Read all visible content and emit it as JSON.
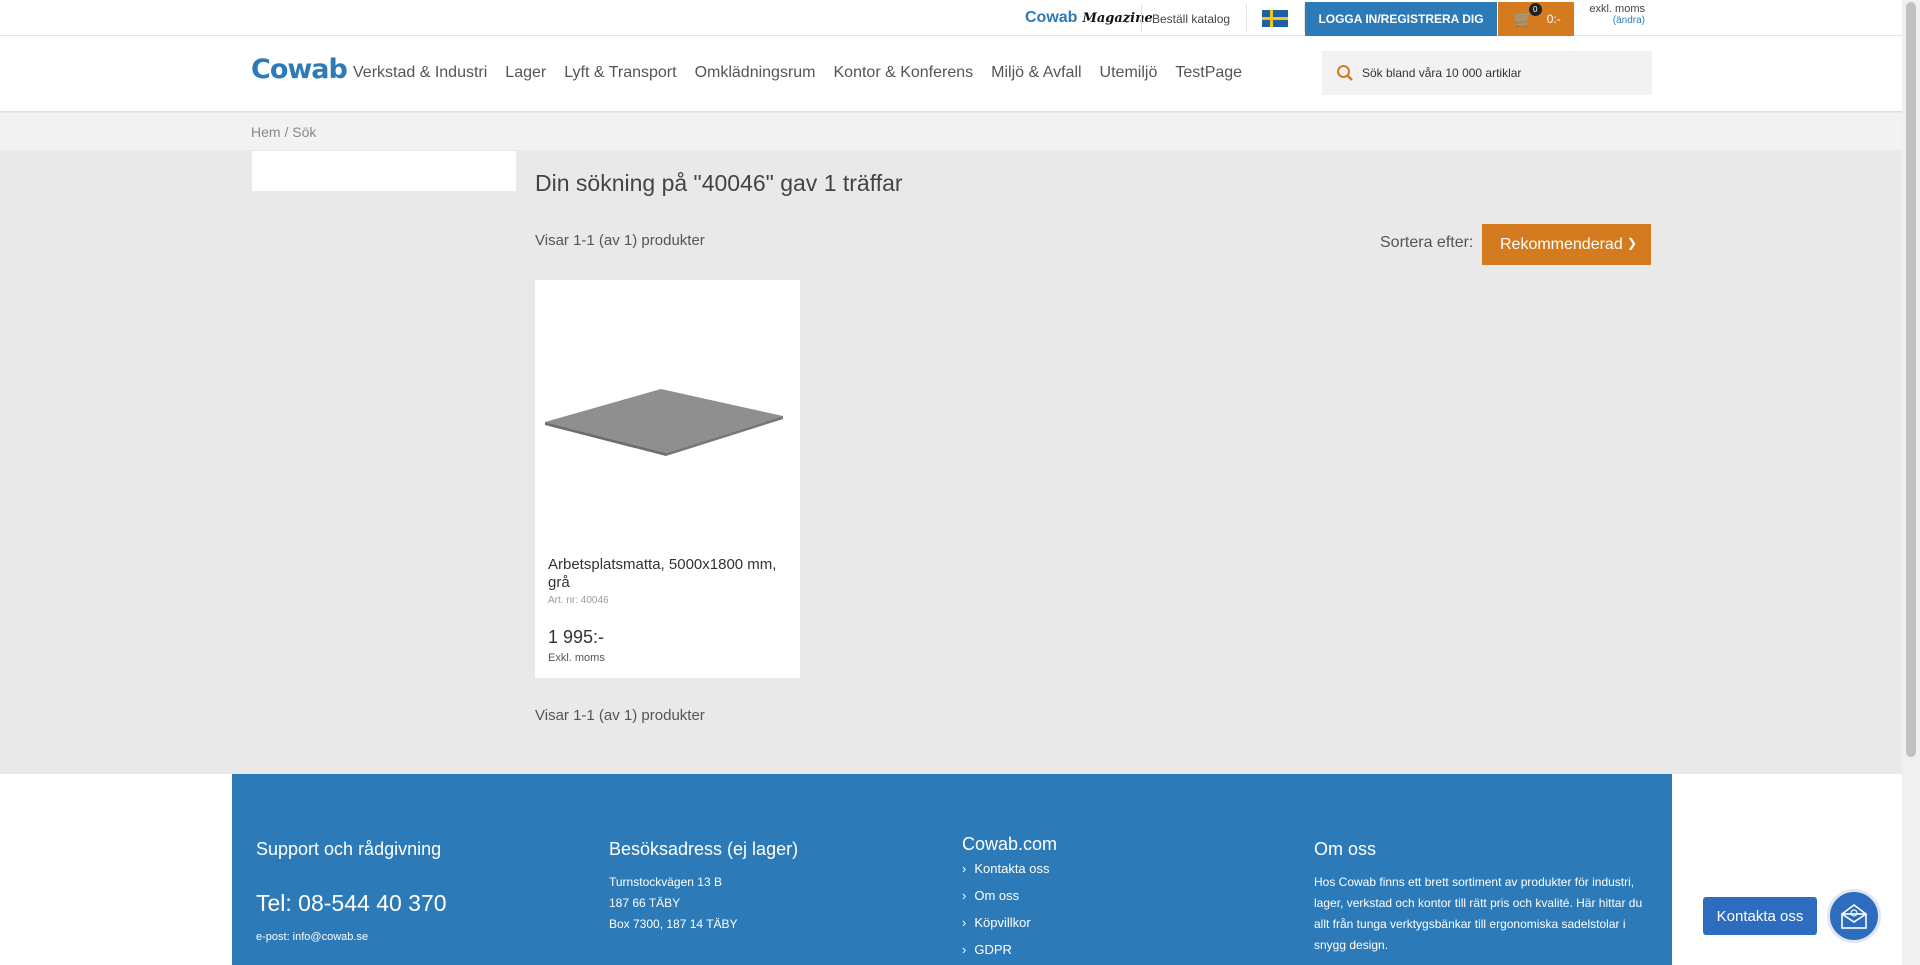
{
  "topbar": {
    "magazine_logo": "Cowab",
    "magazine_word": "Magazine",
    "catalog_link": "Beställ katalog",
    "flag_icon": "sweden-flag-icon",
    "login_button": "LOGGA IN/REGISTRERA DIG",
    "cart_count": "0",
    "cart_total": "0:-",
    "vat_mode": "exkl. moms",
    "vat_change": "(ändra)"
  },
  "header": {
    "logo": "Cowab",
    "nav": [
      "Verkstad & Industri",
      "Lager",
      "Lyft & Transport",
      "Omklädningsrum",
      "Kontor & Konferens",
      "Miljö & Avfall",
      "Utemiljö",
      "TestPage"
    ],
    "search_placeholder": "Sök bland våra 10 000 artiklar"
  },
  "breadcrumb": "Hem / Sök",
  "results": {
    "title": "Din sökning på \"40046\" gav 1 träffar",
    "count_top": "Visar 1-1 (av 1) produkter",
    "count_bottom": "Visar 1-1 (av 1) produkter",
    "sort_label": "Sortera efter:",
    "sort_value": "Rekommenderad"
  },
  "product": {
    "name": "Arbetsplatsmatta, 5000x1800 mm, grå",
    "art_nr": "Art. nr: 40046",
    "price": "1 995:-",
    "vat_note": "Exkl. moms"
  },
  "footer": {
    "support": {
      "heading": "Support och rådgivning",
      "tel": "Tel: 08-544 40 370",
      "email": "e-post: info@cowab.se"
    },
    "address": {
      "heading": "Besöksadress (ej lager)",
      "line1": "Turnstockvägen 13 B",
      "line2": "187 66 TÄBY",
      "line3": "Box 7300, 187 14 TÄBY"
    },
    "links": {
      "heading": "Cowab.com",
      "items": [
        "Kontakta oss",
        "Om oss",
        "Köpvillkor",
        "GDPR"
      ]
    },
    "about": {
      "heading": "Om oss",
      "text": "Hos Cowab finns ett brett sortiment av produkter för industri, lager, verkstad och kontor till rätt pris och kvalité. Här hittar du allt från tunga verktygsbänkar till ergonomiska sadelstolar i snygg design."
    }
  },
  "contact_button": "Kontakta oss",
  "colors": {
    "brand_blue": "#2d7ab8",
    "accent_orange": "#d47b1f"
  }
}
